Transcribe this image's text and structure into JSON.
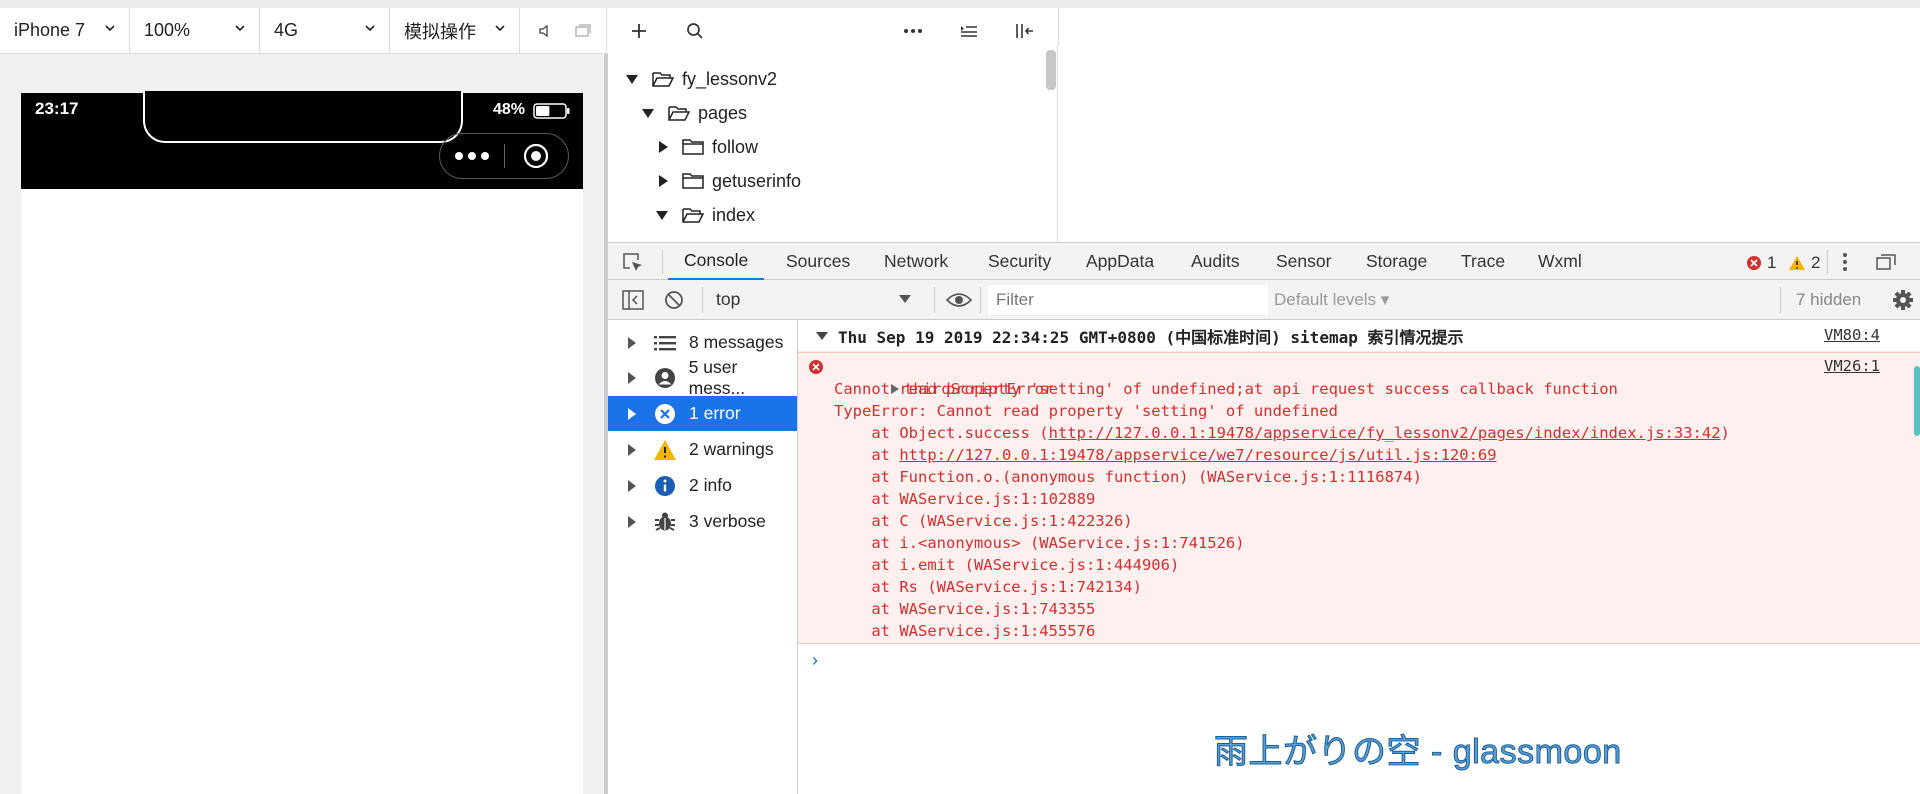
{
  "toolbar": {
    "device": "iPhone 7",
    "zoom": "100%",
    "network": "4G",
    "operation": "模拟操作"
  },
  "phone": {
    "time": "23:17",
    "battery": "48%",
    "battery_level": 0.48
  },
  "tree": [
    {
      "label": "fy_lessonv2",
      "expanded": true
    },
    {
      "label": "pages",
      "expanded": true
    },
    {
      "label": "follow",
      "expanded": false
    },
    {
      "label": "getuserinfo",
      "expanded": false
    },
    {
      "label": "index",
      "expanded": true
    }
  ],
  "devtools": {
    "tabs": [
      "Console",
      "Sources",
      "Network",
      "Security",
      "AppData",
      "Audits",
      "Sensor",
      "Storage",
      "Trace",
      "Wxml"
    ],
    "active_tab": "Console",
    "error_count": "1",
    "warning_count": "2",
    "colors": {
      "accent": "#1a73e8",
      "error": "#d32f2f",
      "warning": "#f2b600"
    }
  },
  "console_bar": {
    "context": "top",
    "filter_placeholder": "Filter",
    "levels": "Default levels ▾",
    "hidden": "7 hidden"
  },
  "sidebar": [
    {
      "label": "8 messages",
      "icon": "list-icon"
    },
    {
      "label": "5 user mess...",
      "icon": "user-icon"
    },
    {
      "label": "1 error",
      "icon": "error-icon",
      "active": true
    },
    {
      "label": "2 warnings",
      "icon": "warning-icon"
    },
    {
      "label": "2 info",
      "icon": "info-icon"
    },
    {
      "label": "3 verbose",
      "icon": "bug-icon"
    }
  ],
  "messages": {
    "group_header": "Thu Sep 19 2019 22:34:25 GMT+0800 (中国标准时间) sitemap 索引情况提示",
    "group_source": "VM80:4",
    "error_title": "thirdScriptError",
    "error_source": "VM26:1",
    "error_lines": [
      "Cannot read property 'setting' of undefined;at api request success callback function",
      "TypeError: Cannot read property 'setting' of undefined"
    ],
    "stack": [
      {
        "prefix": "    at Object.success (",
        "link": "http://127.0.0.1:19478/appservice/fy_lessonv2/pages/index/index.js:33:42",
        "suffix": ")"
      },
      {
        "prefix": "    at ",
        "link": "http://127.0.0.1:19478/appservice/we7/resource/js/util.js:120:69",
        "suffix": ""
      },
      {
        "prefix": "    at Function.o.(anonymous function) (WAService.js:1:1116874)",
        "link": "",
        "suffix": ""
      },
      {
        "prefix": "    at WAService.js:1:102889",
        "link": "",
        "suffix": ""
      },
      {
        "prefix": "    at C (WAService.js:1:422326)",
        "link": "",
        "suffix": ""
      },
      {
        "prefix": "    at i.<anonymous> (WAService.js:1:741526)",
        "link": "",
        "suffix": ""
      },
      {
        "prefix": "    at i.emit (WAService.js:1:444906)",
        "link": "",
        "suffix": ""
      },
      {
        "prefix": "    at Rs (WAService.js:1:742134)",
        "link": "",
        "suffix": ""
      },
      {
        "prefix": "    at WAService.js:1:743355",
        "link": "",
        "suffix": ""
      },
      {
        "prefix": "    at WAService.js:1:455576",
        "link": "",
        "suffix": ""
      }
    ],
    "prompt": "›"
  },
  "watermark": "雨上がりの空 - glassmoon"
}
